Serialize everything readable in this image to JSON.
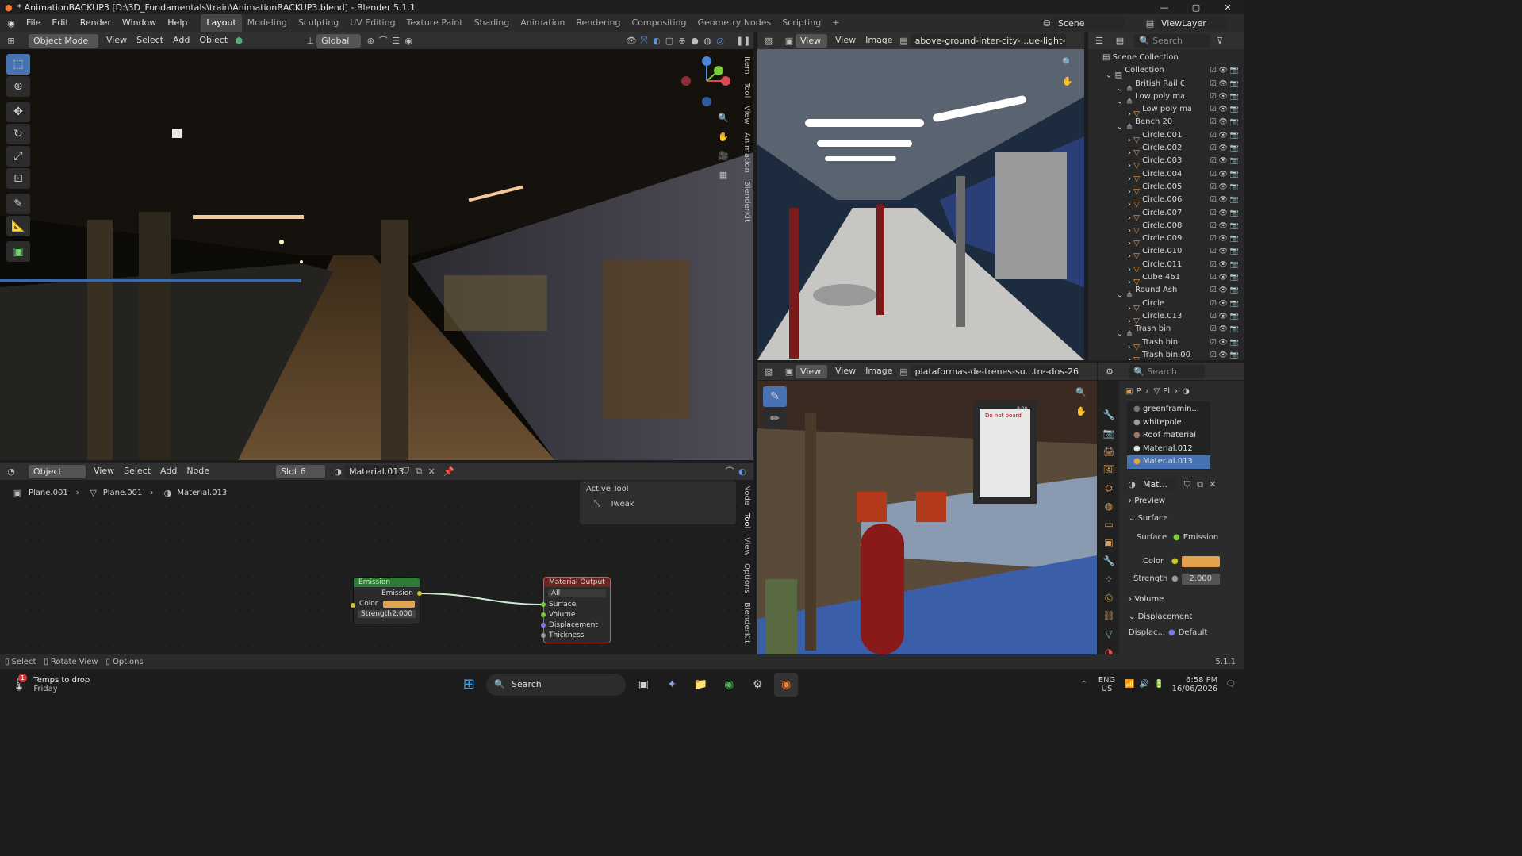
{
  "window": {
    "title": "* AnimationBACKUP3 [D:\\3D_Fundamentals\\train\\AnimationBACKUP3.blend] - Blender 5.1.1",
    "minimize": "—",
    "maximize": "▢",
    "close": "✕"
  },
  "menu": [
    "File",
    "Edit",
    "Render",
    "Window",
    "Help"
  ],
  "workspaces": [
    "Layout",
    "Modeling",
    "Sculpting",
    "UV Editing",
    "Texture Paint",
    "Shading",
    "Animation",
    "Rendering",
    "Compositing",
    "Geometry Nodes",
    "Scripting",
    "+"
  ],
  "scene": {
    "label": "Scene",
    "view_layer": "ViewLayer"
  },
  "viewport": {
    "mode": "Object Mode",
    "menus": [
      "View",
      "Select",
      "Add",
      "Object"
    ],
    "transform": "Global",
    "side_tabs": [
      "Item",
      "Tool",
      "View",
      "Animation",
      "BlenderKit"
    ]
  },
  "node_editor": {
    "type": "Object",
    "menus": [
      "View",
      "Select",
      "Add",
      "Node"
    ],
    "slot": "Slot 6",
    "material": "Material.013",
    "breadcrumb": [
      "Plane.001",
      "Plane.001",
      "Material.013"
    ],
    "side_tabs": [
      "Node",
      "Tool",
      "View",
      "Options",
      "BlenderKit"
    ],
    "active_tool": {
      "title": "Active Tool",
      "tool": "Tweak"
    },
    "emission_node": {
      "title": "Emission",
      "output": "Emission",
      "color_label": "Color",
      "strength_label": "Strength",
      "strength": "2.000"
    },
    "output_node": {
      "title": "Material Output",
      "target": "All",
      "inputs": [
        "Surface",
        "Volume",
        "Displacement",
        "Thickness"
      ]
    }
  },
  "image_top": {
    "menus": [
      "View",
      "View",
      "Image"
    ],
    "name": "above-ground-inter-city-...ue-light-14182"
  },
  "image_bottom": {
    "menus": [
      "View",
      "View",
      "Image"
    ],
    "name": "plataformas-de-trenes-su...tre-dos-26161998",
    "sign_title": "Do not board",
    "sign_time": "8:00"
  },
  "outliner": {
    "search": "Search",
    "root": "Scene Collection",
    "items": [
      {
        "name": "Collection",
        "depth": 0,
        "icon": "collection"
      },
      {
        "name": "British Rail C",
        "depth": 1,
        "icon": "mesh"
      },
      {
        "name": "Low poly ma",
        "depth": 1,
        "icon": "mesh"
      },
      {
        "name": "Low poly ma",
        "depth": 2,
        "icon": "tri"
      },
      {
        "name": "Bench 20",
        "depth": 1,
        "icon": "mesh"
      },
      {
        "name": "Circle.001",
        "depth": 2,
        "icon": "tri"
      },
      {
        "name": "Circle.002",
        "depth": 2,
        "icon": "tri"
      },
      {
        "name": "Circle.003",
        "depth": 2,
        "icon": "tri"
      },
      {
        "name": "Circle.004",
        "depth": 2,
        "icon": "tri"
      },
      {
        "name": "Circle.005",
        "depth": 2,
        "icon": "tri"
      },
      {
        "name": "Circle.006",
        "depth": 2,
        "icon": "tri"
      },
      {
        "name": "Circle.007",
        "depth": 2,
        "icon": "tri"
      },
      {
        "name": "Circle.008",
        "depth": 2,
        "icon": "tri"
      },
      {
        "name": "Circle.009",
        "depth": 2,
        "icon": "tri"
      },
      {
        "name": "Circle.010",
        "depth": 2,
        "icon": "tri"
      },
      {
        "name": "Circle.011",
        "depth": 2,
        "icon": "tri"
      },
      {
        "name": "Cube.461",
        "depth": 2,
        "icon": "tri"
      },
      {
        "name": "Round Ash",
        "depth": 1,
        "icon": "mesh"
      },
      {
        "name": "Circle",
        "depth": 2,
        "icon": "tri"
      },
      {
        "name": "Circle.013",
        "depth": 2,
        "icon": "tri"
      },
      {
        "name": "Trash bin",
        "depth": 1,
        "icon": "mesh"
      },
      {
        "name": "Trash bin",
        "depth": 2,
        "icon": "tri"
      },
      {
        "name": "Trash bin.00",
        "depth": 2,
        "icon": "tri"
      }
    ]
  },
  "properties": {
    "search": "Search",
    "crumb": [
      "P",
      "Pl"
    ],
    "materials": [
      {
        "name": "greenframin...",
        "color": "#777777"
      },
      {
        "name": "whitepole",
        "color": "#999999"
      },
      {
        "name": "Roof material",
        "color": "#a07a66"
      },
      {
        "name": "Material.012",
        "color": "#dcdcdc"
      },
      {
        "name": "Material.013",
        "color": "#e3a24e",
        "selected": true
      }
    ],
    "mat_name": "Mat...",
    "preview": "Preview",
    "surface_panel": "Surface",
    "surface_label": "Surface",
    "surface_value": "Emission",
    "color_label": "Color",
    "color_value": "#e3a24e",
    "strength_label": "Strength",
    "strength_value": "2.000",
    "volume": "Volume",
    "displacement": "Displacement",
    "displac_label": "Displac...",
    "displac_value": "Default"
  },
  "status_bar": {
    "select": "Select",
    "rotate": "Rotate View",
    "options": "Options",
    "version": "5.1.1"
  },
  "taskbar": {
    "weather": "Temps to drop",
    "weather_sub": "Friday",
    "badge": "1",
    "search": "Search",
    "lang1": "ENG",
    "lang2": "US",
    "time": "6:58 PM",
    "date": "16/06/2026"
  }
}
